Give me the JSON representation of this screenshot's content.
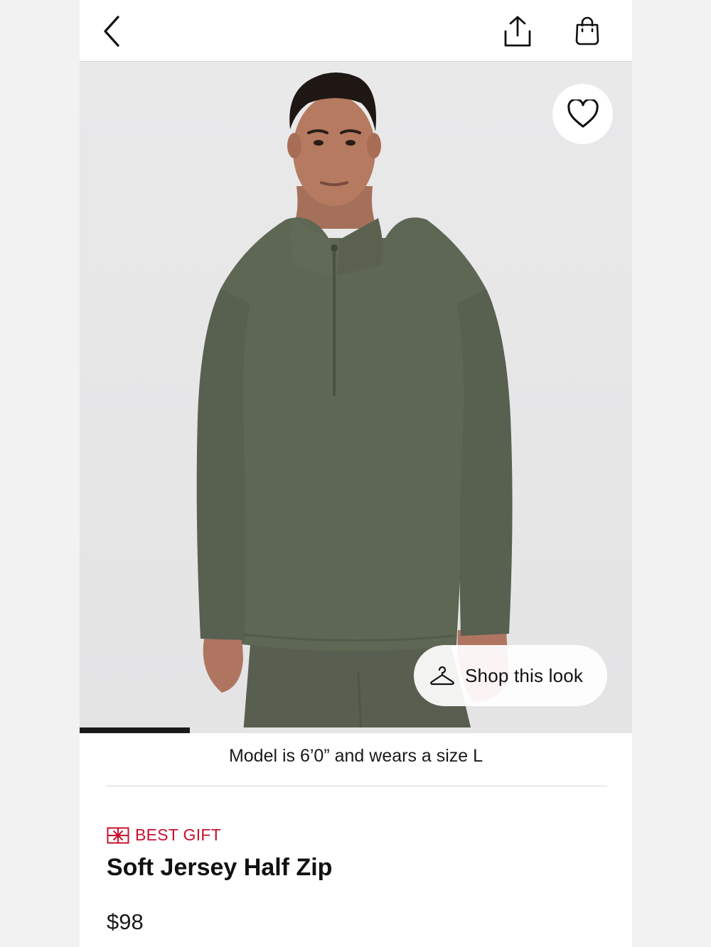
{
  "header": {
    "back_icon": "chevron-left-icon",
    "share_icon": "share-icon",
    "bag_icon": "shopping-bag-icon"
  },
  "gallery": {
    "favorite_icon": "heart-icon",
    "shop_look": {
      "label": "Shop this look",
      "icon": "hanger-icon"
    },
    "progress_fraction": 0.2,
    "product_color": "#5e6654"
  },
  "model_info": "Model is 6’0” and wears a size L",
  "product": {
    "badge": "BEST GIFT",
    "badge_icon": "gift-icon",
    "badge_color": "#c8102e",
    "name": "Soft Jersey Half Zip",
    "price": "$98"
  }
}
